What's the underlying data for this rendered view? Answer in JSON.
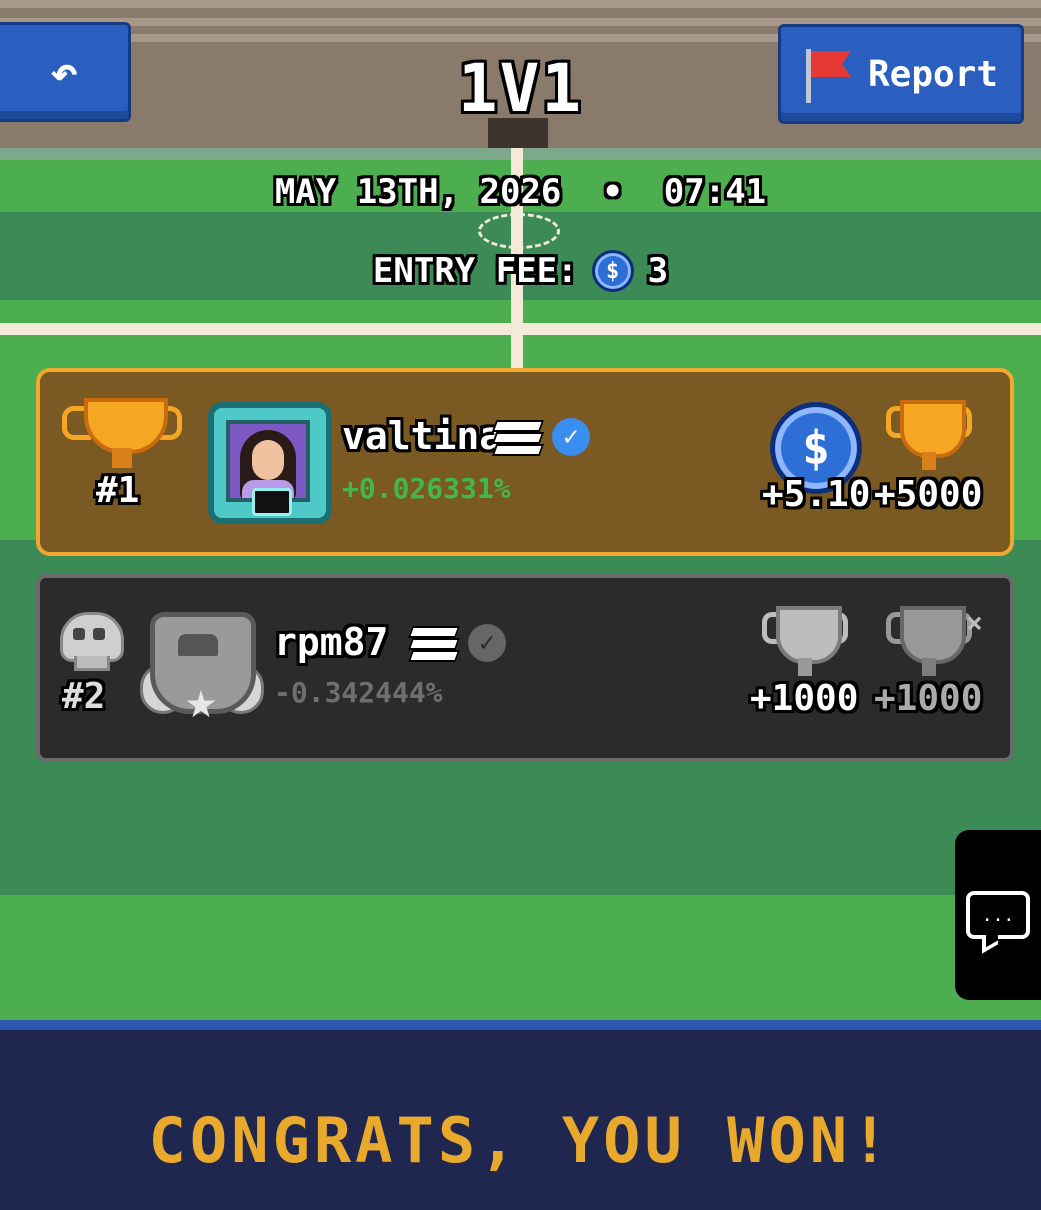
{
  "header": {
    "back_icon": "back-arrow-icon",
    "back_glyph": "↶",
    "title": "1V1",
    "report_label": "Report",
    "report_icon": "red-flag-icon"
  },
  "match": {
    "date": "MAY 13TH, 2026",
    "separator": "•",
    "time": "07:41",
    "entry_fee_label": "ENTRY FEE:",
    "entry_fee_coin_glyph": "$",
    "entry_fee_value": "3"
  },
  "players": [
    {
      "rank": "#1",
      "rank_icon": "gold-trophy-icon",
      "username": "valtina",
      "verified_glyph": "✓",
      "percent_change": "+0.026331%",
      "coin_glyph": "$",
      "reward_coins": "+5.10",
      "reward_trophies": "+5000",
      "accent": "#f0a92e",
      "percent_color": "#43b84a"
    },
    {
      "rank": "#2",
      "rank_icon": "skull-icon",
      "username": "rpm87",
      "verified_glyph": "✓",
      "percent_change": "-0.342444%",
      "reward_trophies_a": "+1000",
      "reward_trophies_b": "+1000",
      "close_glyph": "×",
      "accent": "#6b6b6b",
      "percent_color": "#6f6f6f"
    }
  ],
  "chat": {
    "icon": "chat-bubble-icon",
    "glyph": "..."
  },
  "result": {
    "message": "CONGRATS, YOU WON!",
    "color": "#e9a92c"
  }
}
